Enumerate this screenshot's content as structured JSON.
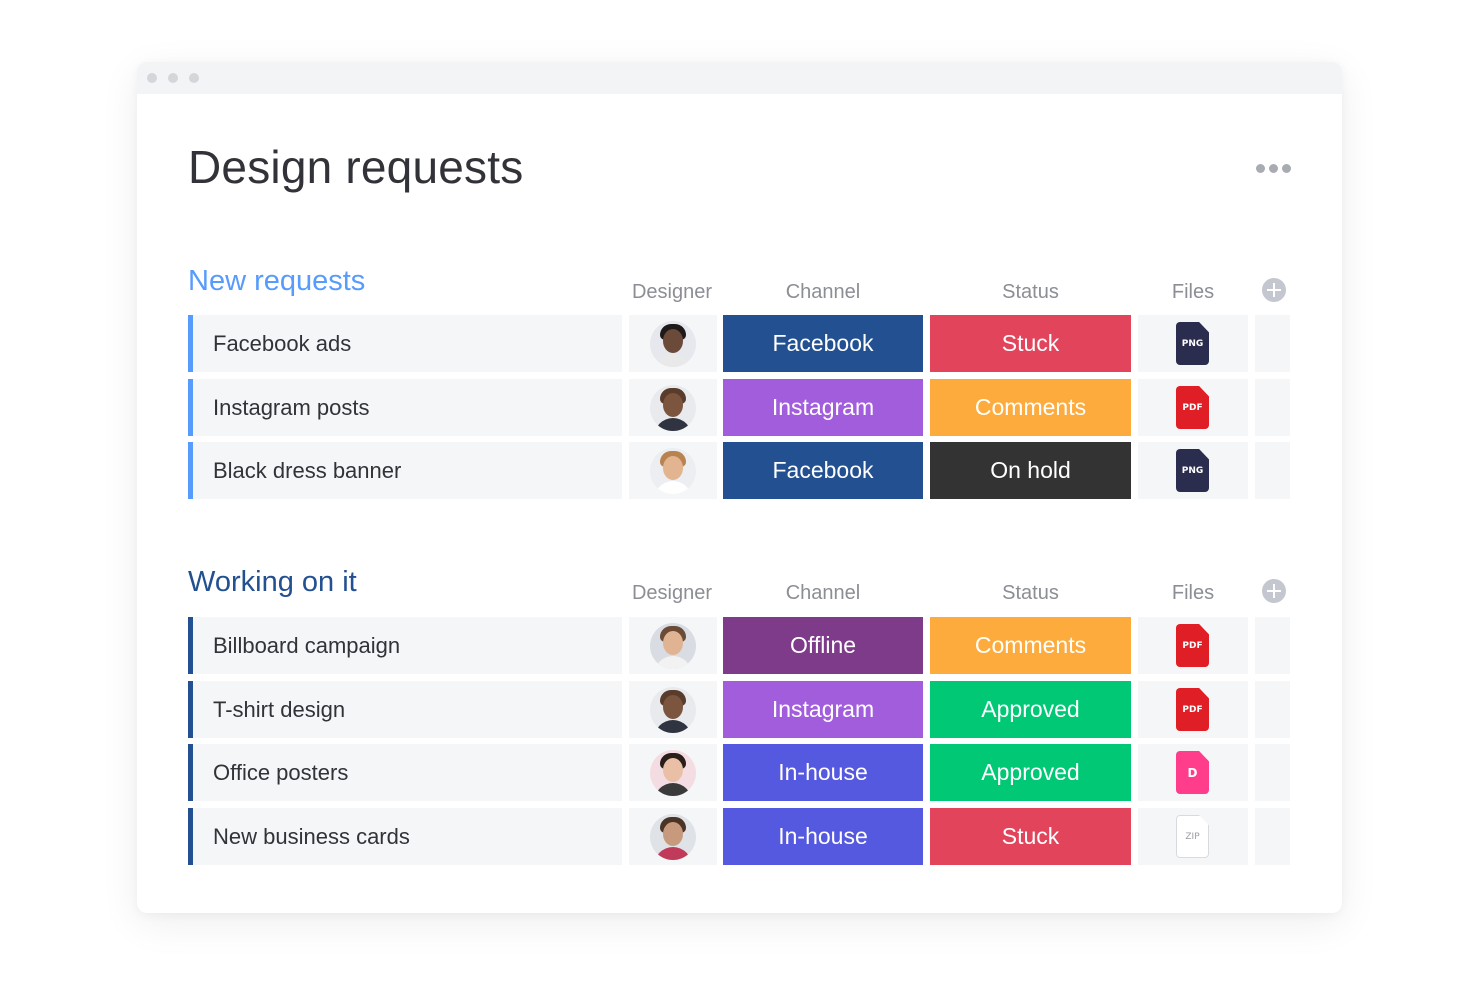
{
  "page": {
    "title": "Design requests"
  },
  "colors": {
    "new_group": "#579bfc",
    "working_group": "#225091",
    "facebook": "#225091",
    "instagram": "#a25ddc",
    "offline": "#7e3b8a",
    "inhouse": "#5559df",
    "stuck": "#e2445c",
    "comments": "#fdab3d",
    "on_hold": "#333333",
    "approved": "#00c875",
    "png": "#2b2d4e",
    "pdf": "#e01e26",
    "d": "#ff3d8b",
    "zip": "#ffffff"
  },
  "columns": {
    "designer": "Designer",
    "channel": "Channel",
    "status": "Status",
    "files": "Files"
  },
  "groups": [
    {
      "title": "New requests",
      "items": [
        {
          "name": "Facebook ads",
          "channel": "Facebook",
          "status": "Stuck",
          "file": "PNG",
          "designer_icon": "avatar-woman-curly"
        },
        {
          "name": "Instagram posts",
          "channel": "Instagram",
          "status": "Comments",
          "file": "PDF",
          "designer_icon": "avatar-man-bald"
        },
        {
          "name": "Black dress banner",
          "channel": "Facebook",
          "status": "On hold",
          "file": "PNG",
          "designer_icon": "avatar-woman-blonde"
        }
      ]
    },
    {
      "title": "Working on it",
      "items": [
        {
          "name": "Billboard campaign",
          "channel": "Offline",
          "status": "Comments",
          "file": "PDF",
          "designer_icon": "avatar-man-beard"
        },
        {
          "name": "T-shirt design",
          "channel": "Instagram",
          "status": "Approved",
          "file": "PDF",
          "designer_icon": "avatar-man-bald"
        },
        {
          "name": "Office posters",
          "channel": "In-house",
          "status": "Approved",
          "file": "D",
          "designer_icon": "avatar-woman-dark"
        },
        {
          "name": "New business cards",
          "channel": "In-house",
          "status": "Stuck",
          "file": "ZIP",
          "designer_icon": "avatar-man-glasses"
        }
      ]
    }
  ]
}
